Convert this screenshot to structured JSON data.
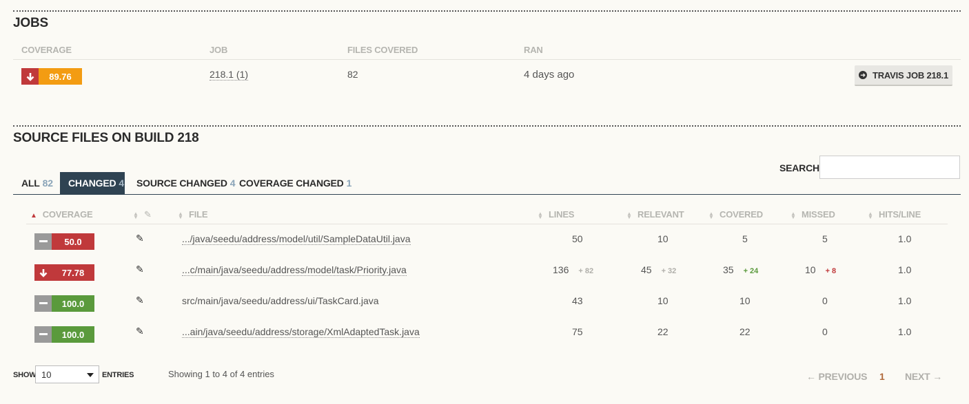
{
  "jobs": {
    "title": "JOBS",
    "headers": [
      "COVERAGE",
      "JOB",
      "FILES COVERED",
      "RAN"
    ],
    "row": {
      "coverage": "89.76",
      "coverage_direction": "down",
      "job": "218.1 (1)",
      "files_covered": "82",
      "ran": "4 days ago",
      "button_label": "TRAVIS JOB 218.1"
    }
  },
  "source": {
    "title": "SOURCE FILES ON BUILD 218",
    "tabs": [
      {
        "label": "ALL",
        "count": "82"
      },
      {
        "label": "CHANGED",
        "count": "4"
      },
      {
        "label": "SOURCE CHANGED",
        "count": "4"
      },
      {
        "label": "COVERAGE CHANGED",
        "count": "1"
      }
    ],
    "search_label": "SEARCH:",
    "search_value": "",
    "headers": [
      "COVERAGE",
      "FILE",
      "LINES",
      "RELEVANT",
      "COVERED",
      "MISSED",
      "HITS/LINE"
    ],
    "rows": [
      {
        "coverage": "50.0",
        "direction": "same",
        "color": "#c0393b",
        "file": ".../java/seedu/address/model/util/SampleDataUtil.java",
        "lines": "50",
        "lines_delta": "",
        "relevant": "10",
        "relevant_delta": "",
        "covered": "5",
        "covered_delta": "",
        "missed": "5",
        "missed_delta": "",
        "hits": "1.0"
      },
      {
        "coverage": "77.78",
        "direction": "down",
        "color": "#c0393b",
        "file": "...c/main/java/seedu/address/model/task/Priority.java",
        "lines": "136",
        "lines_delta": "+ 82",
        "relevant": "45",
        "relevant_delta": "+ 32",
        "covered": "35",
        "covered_delta": "+ 24",
        "missed": "10",
        "missed_delta": "+ 8",
        "hits": "1.0"
      },
      {
        "coverage": "100.0",
        "direction": "same",
        "color": "#5a9a3c",
        "file": "src/main/java/seedu/address/ui/TaskCard.java",
        "lines": "43",
        "lines_delta": "",
        "relevant": "10",
        "relevant_delta": "",
        "covered": "10",
        "covered_delta": "",
        "missed": "0",
        "missed_delta": "",
        "hits": "1.0"
      },
      {
        "coverage": "100.0",
        "direction": "same",
        "color": "#5a9a3c",
        "file": "...ain/java/seedu/address/storage/XmlAdaptedTask.java",
        "lines": "75",
        "lines_delta": "",
        "relevant": "22",
        "relevant_delta": "",
        "covered": "22",
        "covered_delta": "",
        "missed": "0",
        "missed_delta": "",
        "hits": "1.0"
      }
    ],
    "show_label": "SHOW",
    "entries_value": "10",
    "entries_label": "ENTRIES",
    "info": "Showing 1 to 4 of 4 entries",
    "pager": {
      "prev": "← PREVIOUS",
      "page": "1",
      "next": "NEXT →"
    }
  },
  "colors": {
    "orange": "#f39c12",
    "red": "#c0393b",
    "green": "#5a9a3c",
    "gray": "#9a9a9a",
    "tab_active": "#2f4352"
  }
}
